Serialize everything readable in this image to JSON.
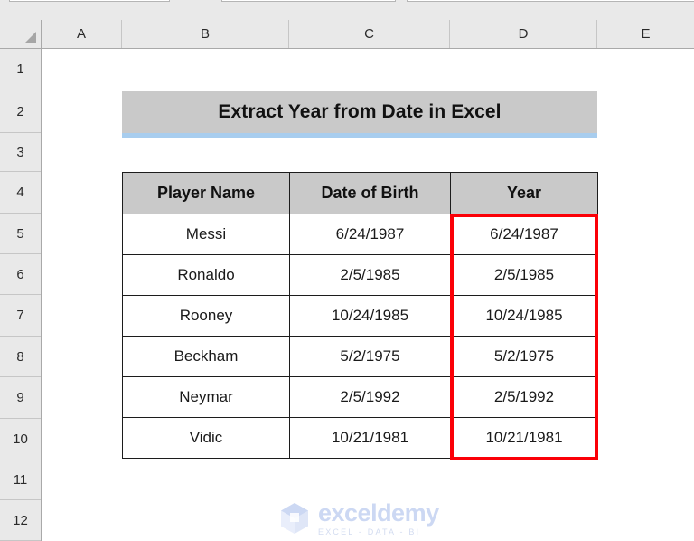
{
  "app": {
    "type": "spreadsheet",
    "chrome": {
      "partial_boxes": [
        "name-box",
        "formula-bar-left",
        "formula-bar-right"
      ]
    }
  },
  "grid": {
    "columns": [
      "A",
      "B",
      "C",
      "D",
      "E"
    ],
    "rows": [
      "1",
      "2",
      "3",
      "4",
      "5",
      "6",
      "7",
      "8",
      "9",
      "10",
      "11",
      "12"
    ],
    "corner_select_all": "select-all-triangle"
  },
  "banner": {
    "title": "Extract Year from Date in Excel",
    "fill_color": "#c9c9c9",
    "accent_color": "#a8cdee"
  },
  "table": {
    "headers": [
      "Player Name",
      "Date of Birth",
      "Year"
    ],
    "rows": [
      {
        "player": "Messi",
        "dob": "6/24/1987",
        "year": "6/24/1987"
      },
      {
        "player": "Ronaldo",
        "dob": "2/5/1985",
        "year": "2/5/1985"
      },
      {
        "player": "Rooney",
        "dob": "10/24/1985",
        "year": "10/24/1985"
      },
      {
        "player": "Beckham",
        "dob": "5/2/1975",
        "year": "5/2/1975"
      },
      {
        "player": "Neymar",
        "dob": "2/5/1992",
        "year": "2/5/1992"
      },
      {
        "player": "Vidic",
        "dob": "10/21/1981",
        "year": "10/21/1981"
      }
    ]
  },
  "highlight": {
    "target_column": "Year",
    "color": "#fb0007"
  },
  "watermark": {
    "name": "exceldemy",
    "tagline": "EXCEL - DATA - BI",
    "color": "#ccd8f3"
  }
}
